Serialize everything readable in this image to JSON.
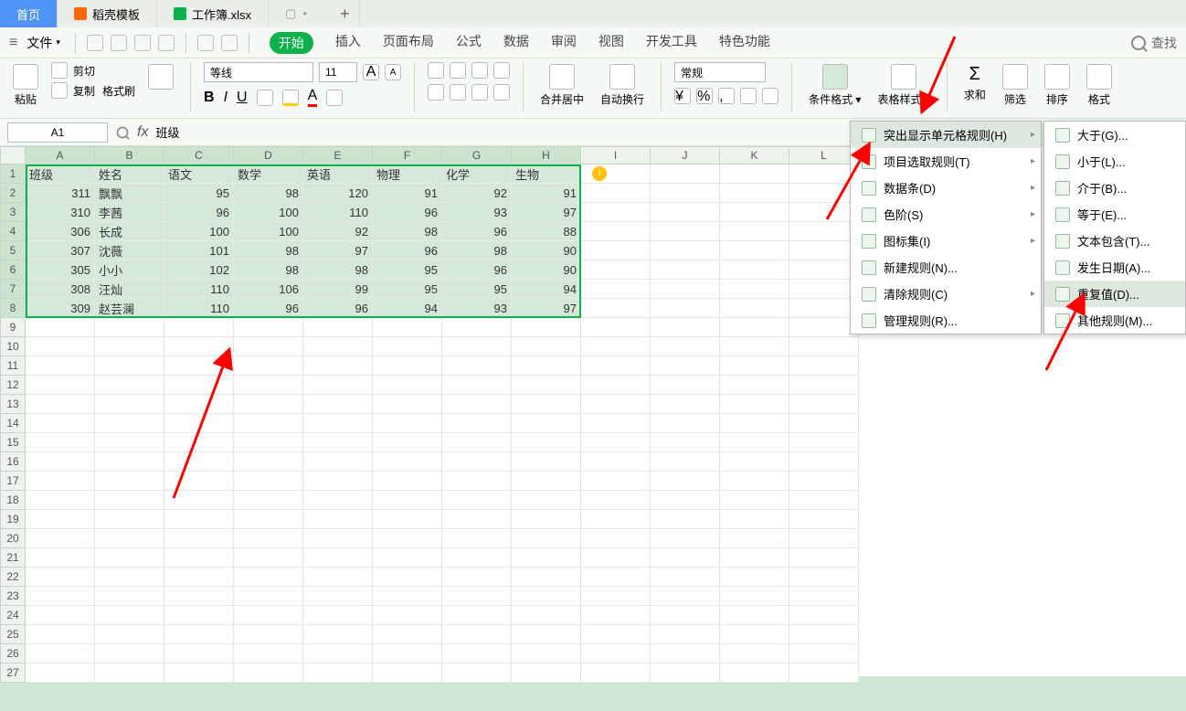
{
  "doc_tabs": {
    "home": "首页",
    "t1": "稻壳模板",
    "t2": "工作簿.xlsx"
  },
  "file_btn": "文件",
  "ribbon_tabs": {
    "start": "开始",
    "insert": "插入",
    "layout": "页面布局",
    "formula": "公式",
    "data": "数据",
    "review": "审阅",
    "view": "视图",
    "dev": "开发工具",
    "special": "特色功能"
  },
  "search_placeholder": "查找",
  "toolbar": {
    "paste": "粘贴",
    "cut": "剪切",
    "copy": "复制",
    "format_painter": "格式刷",
    "font_name": "等线",
    "font_size": "11",
    "merge": "合并居中",
    "wrap": "自动换行",
    "number_format": "常规",
    "cond_fmt": "条件格式",
    "table_style": "表格样式",
    "sum": "求和",
    "filter": "筛选",
    "sort": "排序",
    "format": "格式"
  },
  "cell_ref": "A1",
  "formula_value": "班级",
  "columns": [
    "A",
    "B",
    "C",
    "D",
    "E",
    "F",
    "G",
    "H",
    "I",
    "J",
    "K",
    "L"
  ],
  "headers": [
    "班级",
    "姓名",
    "语文",
    "数学",
    "英语",
    "物理",
    "化学",
    "生物"
  ],
  "rows": [
    {
      "class": "311",
      "name": "飘飘",
      "scores": [
        95,
        98,
        120,
        91,
        92,
        91
      ]
    },
    {
      "class": "310",
      "name": "李茜",
      "scores": [
        96,
        100,
        110,
        96,
        93,
        97
      ]
    },
    {
      "class": "306",
      "name": "长成",
      "scores": [
        100,
        100,
        92,
        98,
        96,
        88
      ]
    },
    {
      "class": "307",
      "name": "沈薇",
      "scores": [
        101,
        98,
        97,
        96,
        98,
        90
      ]
    },
    {
      "class": "305",
      "name": "小小",
      "scores": [
        102,
        98,
        98,
        95,
        96,
        90
      ]
    },
    {
      "class": "308",
      "name": "汪灿",
      "scores": [
        110,
        106,
        99,
        95,
        95,
        94
      ]
    },
    {
      "class": "309",
      "name": "赵芸澜",
      "scores": [
        110,
        96,
        96,
        94,
        93,
        97
      ]
    }
  ],
  "menu1": [
    {
      "label": "突出显示单元格规则(H)",
      "sub": true,
      "hl": true
    },
    {
      "label": "项目选取规则(T)",
      "sub": true
    },
    {
      "label": "数据条(D)",
      "sub": true
    },
    {
      "label": "色阶(S)",
      "sub": true
    },
    {
      "label": "图标集(I)",
      "sub": true
    },
    {
      "label": "新建规则(N)..."
    },
    {
      "label": "清除规则(C)",
      "sub": true
    },
    {
      "label": "管理规则(R)..."
    }
  ],
  "menu2": [
    {
      "label": "大于(G)..."
    },
    {
      "label": "小于(L)..."
    },
    {
      "label": "介于(B)..."
    },
    {
      "label": "等于(E)..."
    },
    {
      "label": "文本包含(T)..."
    },
    {
      "label": "发生日期(A)..."
    },
    {
      "label": "重复值(D)...",
      "hl": true
    },
    {
      "label": "其他规则(M)..."
    }
  ]
}
